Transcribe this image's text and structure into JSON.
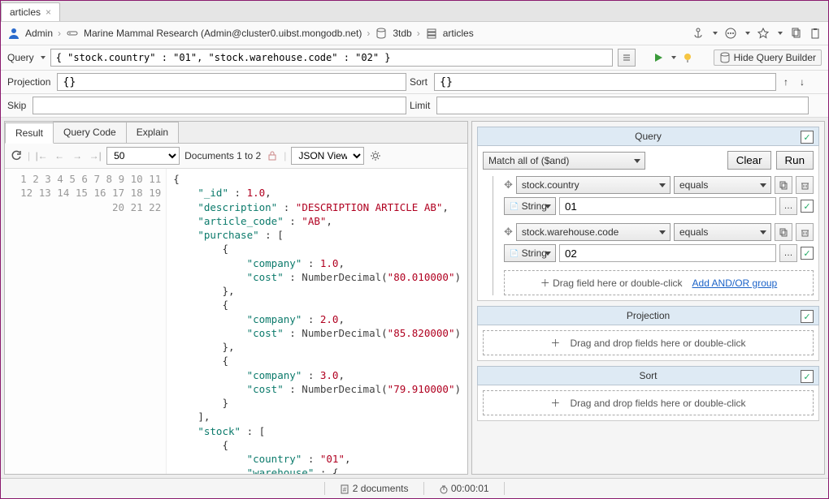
{
  "tab": {
    "title": "articles"
  },
  "breadcrumb": {
    "user": "Admin",
    "connection": "Marine Mammal Research (Admin@cluster0.uibst.mongodb.net)",
    "db": "3tdb",
    "collection": "articles"
  },
  "queryBar": {
    "label": "Query",
    "text": "{ \"stock.country\" : \"01\", \"stock.warehouse.code\" : \"02\" }",
    "hideBuilder": "Hide Query Builder"
  },
  "filters": {
    "projection": {
      "label": "Projection",
      "value": "{}"
    },
    "sort": {
      "label": "Sort",
      "value": "{}"
    },
    "skip": {
      "label": "Skip",
      "value": ""
    },
    "limit": {
      "label": "Limit",
      "value": ""
    }
  },
  "subtabs": {
    "result": "Result",
    "queryCode": "Query Code",
    "explain": "Explain"
  },
  "resultBar": {
    "pageSize": "50",
    "docRange": "Documents 1 to 2",
    "viewMode": "JSON View"
  },
  "json": {
    "lines": 22,
    "doc": {
      "_id": "1.0",
      "description": "DESCRIPTION ARTICLE AB",
      "article_code": "AB",
      "purchase": [
        {
          "company": "1.0",
          "cost_fn": "NumberDecimal",
          "cost": "80.010000"
        },
        {
          "company": "2.0",
          "cost_fn": "NumberDecimal",
          "cost": "85.820000"
        },
        {
          "company": "3.0",
          "cost_fn": "NumberDecimal",
          "cost": "79.910000"
        }
      ],
      "stock_country": "01"
    }
  },
  "builder": {
    "queryTitle": "Query",
    "matchMode": "Match all of ($and)",
    "clear": "Clear",
    "run": "Run",
    "conditions": [
      {
        "field": "stock.country",
        "op": "equals",
        "type": "String",
        "value": "01"
      },
      {
        "field": "stock.warehouse.code",
        "op": "equals",
        "type": "String",
        "value": "02"
      }
    ],
    "dragHint": "Drag field here or double-click",
    "addGroup": "Add AND/OR group",
    "projection": {
      "title": "Projection",
      "hint": "Drag and drop fields here or double-click"
    },
    "sort": {
      "title": "Sort",
      "hint": "Drag and drop fields here or double-click"
    }
  },
  "status": {
    "docs": "2 documents",
    "time": "00:00:01"
  }
}
